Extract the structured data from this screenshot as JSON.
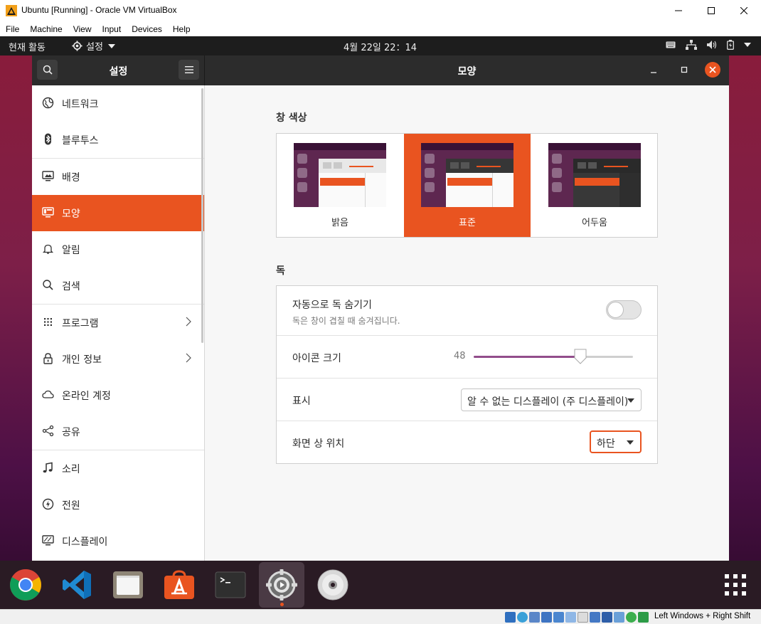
{
  "vbox": {
    "title": "Ubuntu [Running] - Oracle VM VirtualBox",
    "menu": [
      "File",
      "Machine",
      "View",
      "Input",
      "Devices",
      "Help"
    ],
    "status_hostkey": "Left Windows + Right Shift"
  },
  "topbar": {
    "activities": "현재 활동",
    "app_menu": "설정",
    "clock": "4월 22일  22：14"
  },
  "headerbar": {
    "sidebar_title": "설정",
    "page_title": "모양"
  },
  "sidebar": {
    "items": [
      {
        "label": "네트워크",
        "icon": "globe-icon"
      },
      {
        "label": "블루투스",
        "icon": "bluetooth-icon"
      },
      {
        "label": "배경",
        "icon": "monitor-icon"
      },
      {
        "label": "모양",
        "icon": "appearance-icon",
        "active": true
      },
      {
        "label": "알림",
        "icon": "bell-icon"
      },
      {
        "label": "검색",
        "icon": "search-icon"
      },
      {
        "label": "프로그램",
        "icon": "apps-grid-icon",
        "chevron": true
      },
      {
        "label": "개인 정보",
        "icon": "lock-icon",
        "chevron": true
      },
      {
        "label": "온라인 계정",
        "icon": "cloud-icon"
      },
      {
        "label": "공유",
        "icon": "share-icon"
      },
      {
        "label": "소리",
        "icon": "music-note-icon"
      },
      {
        "label": "전원",
        "icon": "power-icon"
      },
      {
        "label": "디스플레이",
        "icon": "display-icon"
      }
    ]
  },
  "main": {
    "window_colors_title": "창 색상",
    "themes": [
      {
        "name": "밝음",
        "selected": false
      },
      {
        "name": "표준",
        "selected": true
      },
      {
        "name": "어두움",
        "selected": false
      }
    ],
    "dock_title": "독",
    "dock": {
      "autohide_label": "자동으로 독 숨기기",
      "autohide_sub": "독은 창이 겹칠 때 숨겨집니다.",
      "autohide_on": false,
      "icon_size_label": "아이콘 크기",
      "icon_size_value": "48",
      "icon_size_fraction": 0.67,
      "show_on_label": "표시",
      "show_on_value": "알 수 없는 디스플레이 (주 디스플레이)",
      "position_label": "화면 상 위치",
      "position_value": "하단"
    }
  },
  "dock_apps": [
    {
      "name": "chrome-icon"
    },
    {
      "name": "vscode-icon"
    },
    {
      "name": "files-icon"
    },
    {
      "name": "software-icon"
    },
    {
      "name": "terminal-icon"
    },
    {
      "name": "settings-icon",
      "active": true
    },
    {
      "name": "disc-icon"
    }
  ],
  "colors": {
    "accent": "#e95420",
    "slider": "#924d8b",
    "topbar": "#1d1d1d",
    "headerbar": "#2c2c2c"
  }
}
